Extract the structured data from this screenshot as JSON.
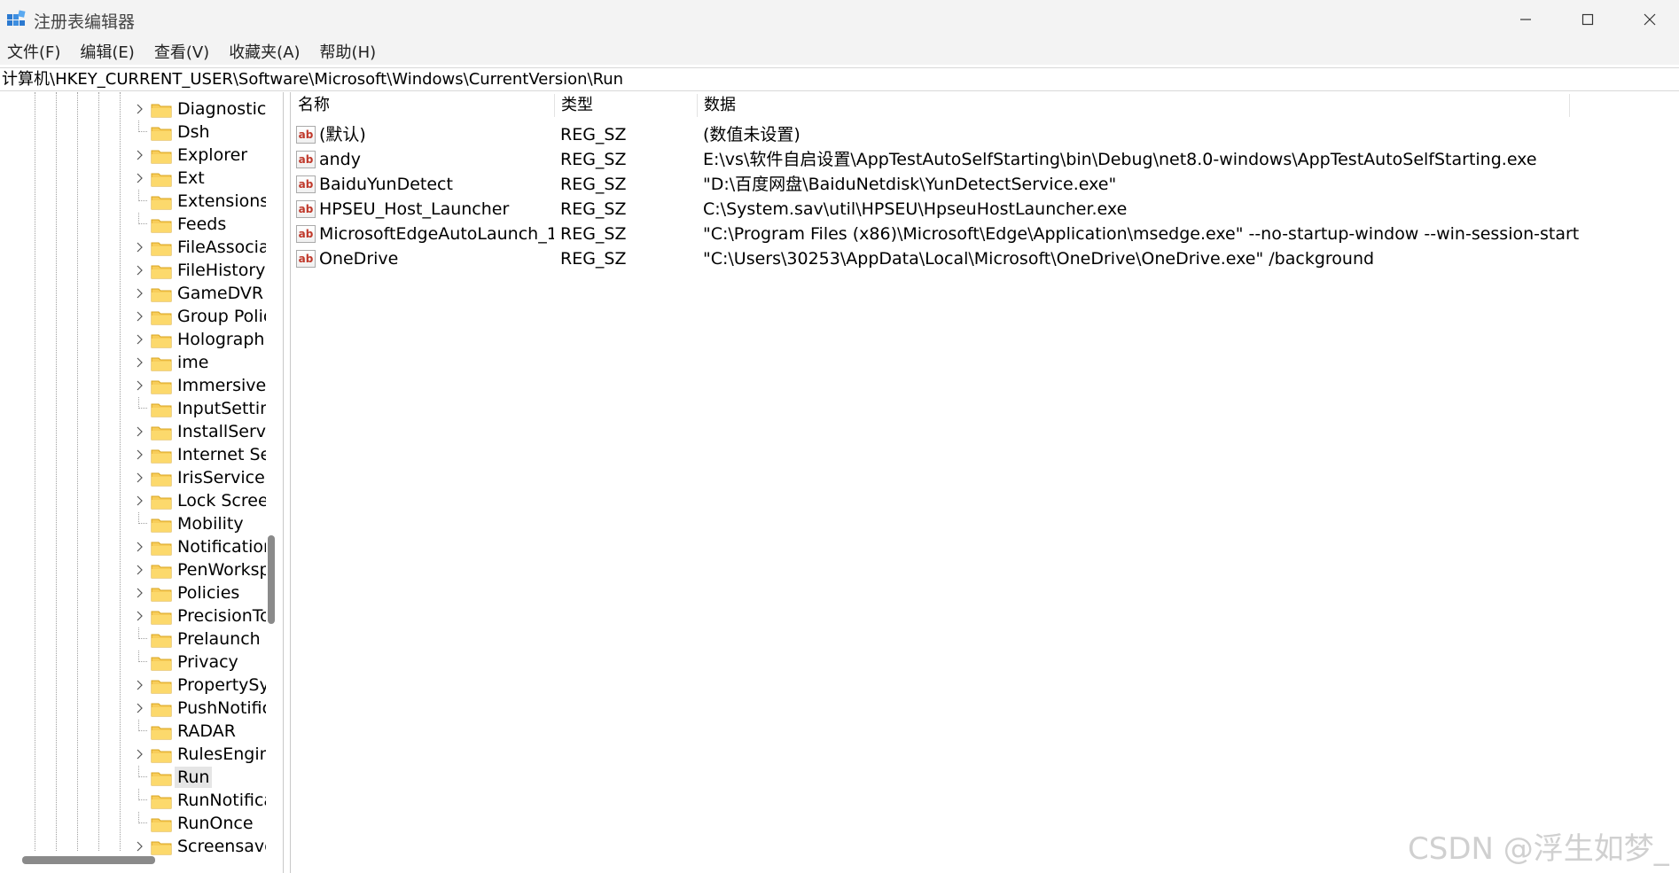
{
  "window": {
    "title": "注册表编辑器",
    "controls": {
      "minimize": "minimize-icon",
      "maximize": "maximize-icon",
      "close": "close-icon"
    }
  },
  "menu": {
    "items": [
      "文件(F)",
      "编辑(E)",
      "查看(V)",
      "收藏夹(A)",
      "帮助(H)"
    ]
  },
  "address": {
    "path": "计算机\\HKEY_CURRENT_USER\\Software\\Microsoft\\Windows\\CurrentVersion\\Run"
  },
  "tree": {
    "items": [
      {
        "label": "Diagnostics",
        "expandable": true
      },
      {
        "label": "Dsh",
        "expandable": false
      },
      {
        "label": "Explorer",
        "expandable": true
      },
      {
        "label": "Ext",
        "expandable": true
      },
      {
        "label": "Extensions",
        "expandable": false
      },
      {
        "label": "Feeds",
        "expandable": false
      },
      {
        "label": "FileAssociations",
        "expandable": true
      },
      {
        "label": "FileHistory",
        "expandable": true
      },
      {
        "label": "GameDVR",
        "expandable": true
      },
      {
        "label": "Group Policy",
        "expandable": true
      },
      {
        "label": "Holographic",
        "expandable": true
      },
      {
        "label": "ime",
        "expandable": true
      },
      {
        "label": "ImmersiveShell",
        "expandable": true
      },
      {
        "label": "InputSettings",
        "expandable": false
      },
      {
        "label": "InstallService",
        "expandable": true
      },
      {
        "label": "Internet Settings",
        "expandable": true
      },
      {
        "label": "IrisService",
        "expandable": true
      },
      {
        "label": "Lock Screen",
        "expandable": true
      },
      {
        "label": "Mobility",
        "expandable": false
      },
      {
        "label": "Notifications",
        "expandable": true
      },
      {
        "label": "PenWorkspace",
        "expandable": true
      },
      {
        "label": "Policies",
        "expandable": true
      },
      {
        "label": "PrecisionTouchPad",
        "expandable": true
      },
      {
        "label": "Prelaunch",
        "expandable": false
      },
      {
        "label": "Privacy",
        "expandable": false
      },
      {
        "label": "PropertySystem",
        "expandable": true
      },
      {
        "label": "PushNotifications",
        "expandable": true
      },
      {
        "label": "RADAR",
        "expandable": false
      },
      {
        "label": "RulesEngine",
        "expandable": true
      },
      {
        "label": "Run",
        "expandable": false,
        "selected": true
      },
      {
        "label": "RunNotification",
        "expandable": false
      },
      {
        "label": "RunOnce",
        "expandable": false
      },
      {
        "label": "Screensavers",
        "expandable": true
      }
    ]
  },
  "values_table": {
    "headers": {
      "name": "名称",
      "type": "类型",
      "data": "数据"
    },
    "rows": [
      {
        "name": "(默认)",
        "type": "REG_SZ",
        "data": "(数值未设置)"
      },
      {
        "name": "andy",
        "type": "REG_SZ",
        "data": "E:\\vs\\软件自启设置\\AppTestAutoSelfStarting\\bin\\Debug\\net8.0-windows\\AppTestAutoSelfStarting.exe"
      },
      {
        "name": "BaiduYunDetect",
        "type": "REG_SZ",
        "data": "\"D:\\百度网盘\\BaiduNetdisk\\YunDetectService.exe\""
      },
      {
        "name": "HPSEU_Host_Launcher",
        "type": "REG_SZ",
        "data": "C:\\System.sav\\util\\HPSEU\\HpseuHostLauncher.exe"
      },
      {
        "name": "MicrosoftEdgeAutoLaunch_1...",
        "type": "REG_SZ",
        "data": "\"C:\\Program Files (x86)\\Microsoft\\Edge\\Application\\msedge.exe\" --no-startup-window --win-session-start"
      },
      {
        "name": "OneDrive",
        "type": "REG_SZ",
        "data": "\"C:\\Users\\30253\\AppData\\Local\\Microsoft\\OneDrive\\OneDrive.exe\" /background"
      }
    ],
    "value_icon": "string-value-icon",
    "value_icon_text": "ab"
  },
  "watermark": "CSDN @浮生如梦_"
}
